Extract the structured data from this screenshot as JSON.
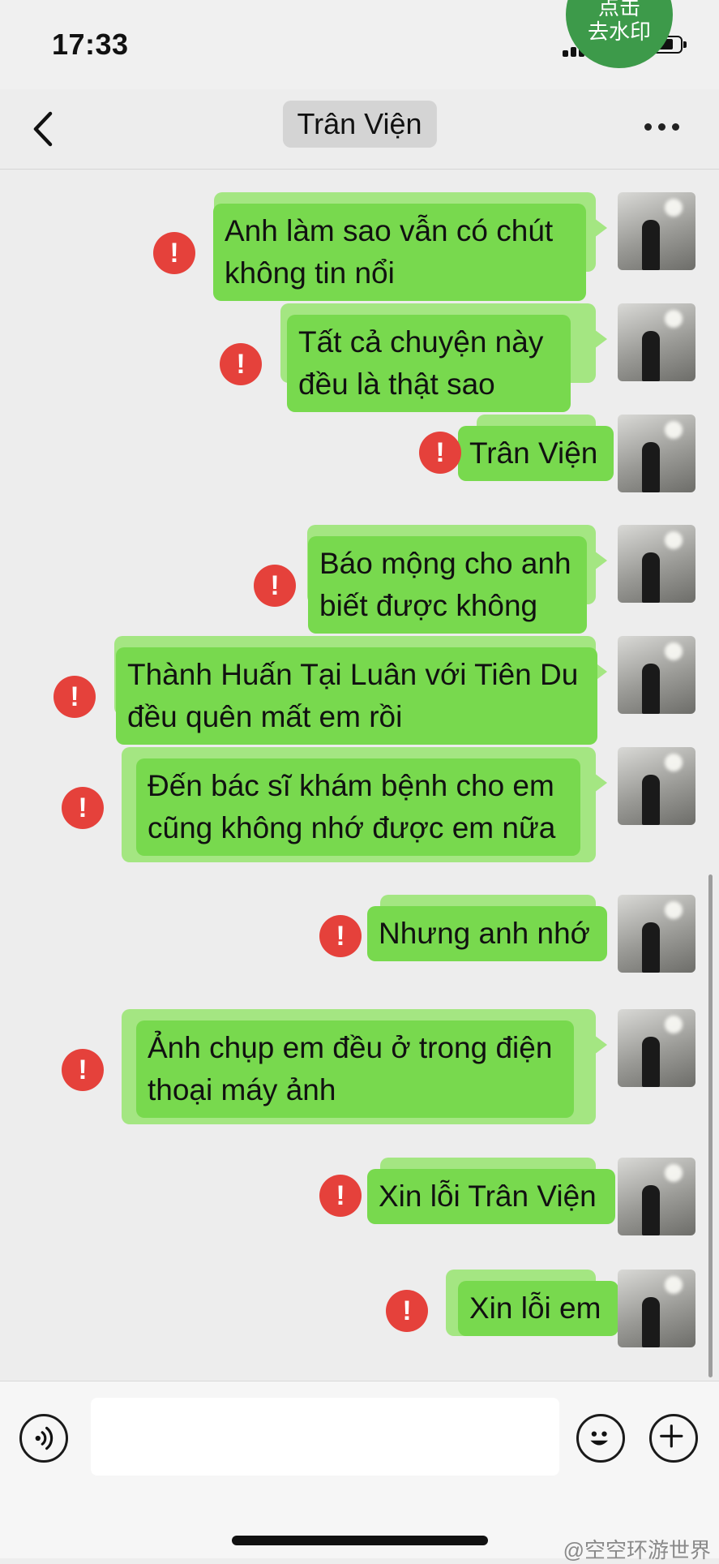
{
  "status_bar": {
    "time": "17:33",
    "watermark_badge": [
      "点击",
      "去水印"
    ]
  },
  "header": {
    "contact_name": "Trân Viện",
    "back_icon": "chevron-left-icon",
    "more_icon": "ellipsis-icon"
  },
  "messages": [
    {
      "lines": [
        "Anh làm sao vẫn có chút",
        "không tin nổi"
      ],
      "status": "failed"
    },
    {
      "lines": [
        "Tất cả chuyện này",
        "đều là thật sao"
      ],
      "status": "failed"
    },
    {
      "lines": [
        "Trân Viện"
      ],
      "status": "failed"
    },
    {
      "lines": [
        "Báo mộng cho anh",
        "biết được không"
      ],
      "status": "failed"
    },
    {
      "lines": [
        "Thành Huấn Tại Luân với Tiên Du",
        "đều quên mất em rồi"
      ],
      "status": "failed"
    },
    {
      "lines": [
        "Đến bác sĩ khám bệnh cho em",
        "cũng không nhớ được em nữa"
      ],
      "status": "failed"
    },
    {
      "lines": [
        "Nhưng anh nhớ"
      ],
      "status": "failed"
    },
    {
      "lines": [
        "Ảnh chụp em đều ở trong điện",
        "thoại máy ảnh"
      ],
      "status": "failed"
    },
    {
      "lines": [
        "Xin lỗi Trân Viện"
      ],
      "status": "failed"
    },
    {
      "lines": [
        "Xin lỗi em"
      ],
      "status": "failed"
    }
  ],
  "alert_glyph": "!",
  "input_bar": {
    "voice_icon": "voice-icon",
    "emoji_icon": "emoji-icon",
    "plus_icon": "plus-icon",
    "input_value": ""
  },
  "credit": "@空空环游世界",
  "colors": {
    "bubble": "#78d94e",
    "bubble_halo": "#a4e682",
    "alert": "#e5413b",
    "background": "#ededed"
  }
}
